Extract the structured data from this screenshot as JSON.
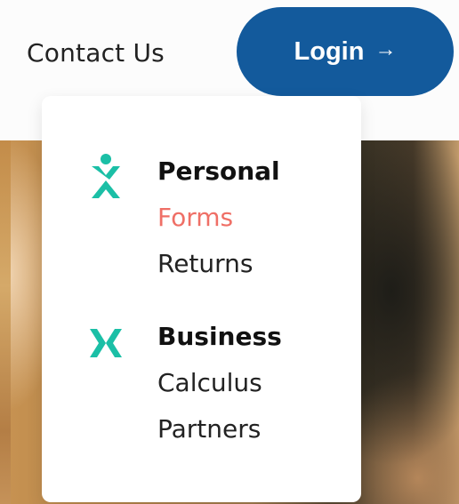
{
  "header": {
    "contact_label": "Contact Us",
    "login_label": "Login",
    "login_arrow": "→"
  },
  "menu": {
    "groups": [
      {
        "heading": "Personal",
        "icon": "person-icon",
        "links": [
          "Forms",
          "Returns"
        ],
        "active_link": "Forms"
      },
      {
        "heading": "Business",
        "icon": "business-icon",
        "links": [
          "Calculus",
          "Partners"
        ]
      }
    ]
  },
  "colors": {
    "brand_blue": "#135a9c",
    "accent_teal": "#1bbfa6",
    "active_link": "#ef6f66"
  }
}
